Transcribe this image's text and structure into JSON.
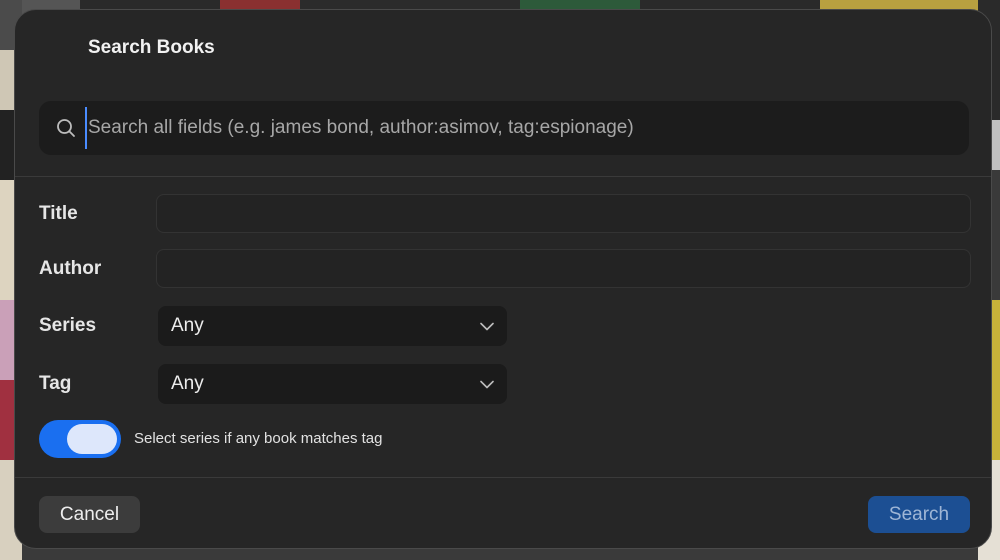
{
  "dialog": {
    "title": "Search Books"
  },
  "search": {
    "placeholder": "Search all fields (e.g. james bond, author:asimov, tag:espionage)",
    "value": ""
  },
  "fields": {
    "title_label": "Title",
    "title_value": "",
    "author_label": "Author",
    "author_value": "",
    "series_label": "Series",
    "series_selected": "Any",
    "tag_label": "Tag",
    "tag_selected": "Any"
  },
  "toggle": {
    "label": "Select series if any book matches tag",
    "enabled": true
  },
  "buttons": {
    "cancel_label": "Cancel",
    "search_label": "Search"
  },
  "icons": {
    "search": "magnifier-icon",
    "dropdown": "chevron-down-icon"
  },
  "colors": {
    "accent": "#1a6ff0",
    "primary_button": "#1c4f93"
  }
}
